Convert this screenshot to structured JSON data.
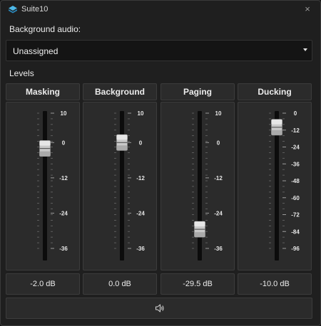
{
  "window": {
    "title": "Suite10",
    "close_glyph": "×"
  },
  "background_audio": {
    "label": "Background audio:",
    "selected": "Unassigned"
  },
  "levels_label": "Levels",
  "channels": [
    {
      "name": "Masking",
      "value_text": "-2.0  dB",
      "fader_db": -2.0,
      "scale": {
        "max": 10,
        "min": -36,
        "labels": [
          "10",
          "0",
          "-12",
          "-24",
          "-36"
        ],
        "label_values": [
          10,
          0,
          -12,
          -24,
          -36
        ]
      }
    },
    {
      "name": "Background",
      "value_text": "0.0  dB",
      "fader_db": 0.0,
      "scale": {
        "max": 10,
        "min": -36,
        "labels": [
          "10",
          "0",
          "-12",
          "-24",
          "-36"
        ],
        "label_values": [
          10,
          0,
          -12,
          -24,
          -36
        ]
      }
    },
    {
      "name": "Paging",
      "value_text": "-29.5  dB",
      "fader_db": -29.5,
      "scale": {
        "max": 10,
        "min": -36,
        "labels": [
          "10",
          "0",
          "-12",
          "-24",
          "-36"
        ],
        "label_values": [
          10,
          0,
          -12,
          -24,
          -36
        ]
      }
    },
    {
      "name": "Ducking",
      "value_text": "-10.0  dB",
      "fader_db": -10.0,
      "scale": {
        "max": 0,
        "min": -96,
        "labels": [
          "0",
          "-12",
          "-24",
          "-36",
          "-48",
          "-60",
          "-72",
          "-84",
          "-96"
        ],
        "label_values": [
          0,
          -12,
          -24,
          -36,
          -48,
          -60,
          -72,
          -84,
          -96
        ]
      }
    }
  ],
  "icons": {
    "app": "suite-logo-icon",
    "dropdown": "chevron-down-icon",
    "speaker": "speaker-icon"
  },
  "colors": {
    "window_bg": "#1f1f1f",
    "panel_bg": "#2b2b2b",
    "track": "#0c0c0c",
    "text": "#ececec"
  }
}
